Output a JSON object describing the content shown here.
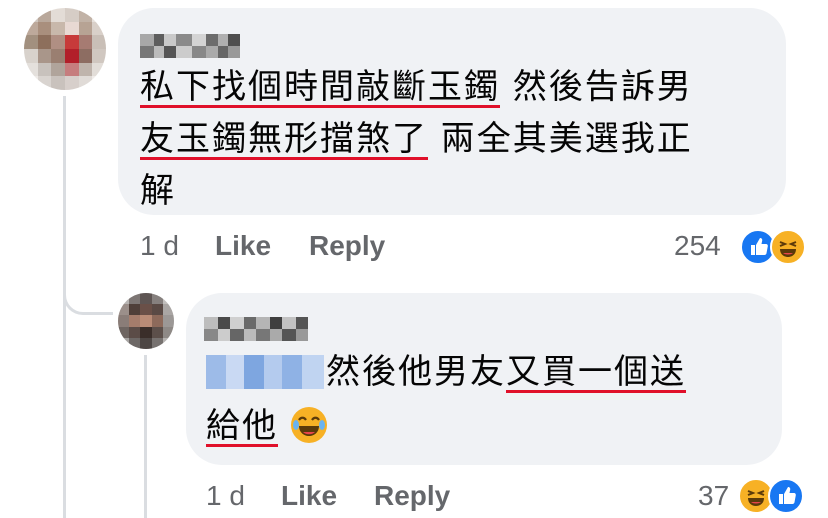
{
  "comment1": {
    "lines": [
      {
        "underlined": "私下找個時間敲斷玉鐲",
        "plain": " 然後告訴男"
      },
      {
        "underlined": "友玉鐲無形擋煞了",
        "plain": " 兩全其美選我正"
      },
      {
        "underlined": "",
        "plain": "解"
      }
    ],
    "time": "1 d",
    "like_label": "Like",
    "reply_label": "Reply",
    "reaction_count": "254"
  },
  "comment2": {
    "line1_plain": " 然後他男友",
    "line1_underlined": "又買一個送",
    "line2_underlined": "給他",
    "time": "1 d",
    "like_label": "Like",
    "reply_label": "Reply",
    "reaction_count": "37"
  },
  "colors": {
    "bubble": "#f0f2f5",
    "meta_text": "#65676b",
    "underline": "#e0102a",
    "like_blue": "#1877f2",
    "haha_yellow": "#f7b125"
  },
  "icons": [
    "avatar-blurred",
    "thumbs-up-reaction-icon",
    "laughing-reaction-icon",
    "tears-of-joy-emoji"
  ]
}
